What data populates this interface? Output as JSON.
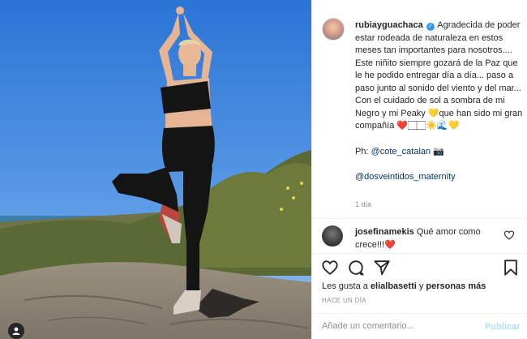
{
  "post": {
    "username": "rubiayguachaca",
    "caption_lines": [
      "Agradecida de poder estar rodeada de naturaleza en estos meses tan importantes para nosotros....",
      "Este niñito siempre gozará de la Paz que le he podido entregar día a día... paso a paso junto al sonido del viento y del mar...",
      "Con el cuidado de sol a sombra de mi Negro y mi Peaky 💛que han sido mi gran compañía ❤️🏻🏻☀️🌊💛"
    ],
    "photo_credit_prefix": "Ph: ",
    "photo_credit_handle": "@cote_catalan",
    "photo_credit_suffix": " 📷",
    "brand_handle": "@dosveintidos_maternity",
    "caption_time": "1 día"
  },
  "comment": {
    "username": "josefinamekis",
    "text": "Qué amor como crece!!!❤️"
  },
  "likes": {
    "prefix": "Les gusta a ",
    "user": "elialbasetti",
    "middle": " y ",
    "others": "personas más"
  },
  "posted_ago": "HACE UN DÍA",
  "add_comment": {
    "placeholder": "Añade un comentario...",
    "publish_label": "Publicar"
  },
  "colors": {
    "link": "#00376b",
    "publish": "#b2dffc",
    "verified": "#3897f0",
    "heart_red": "#ed4956"
  }
}
